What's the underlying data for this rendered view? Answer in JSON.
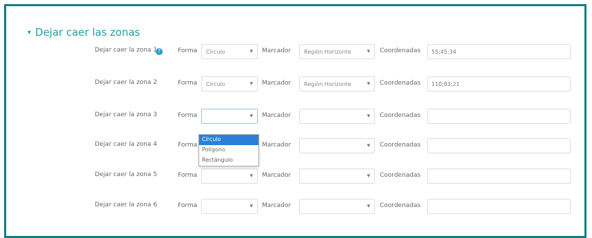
{
  "section": {
    "title": "Dejar caer las zonas",
    "caret": "▾"
  },
  "labels": {
    "shape": "Forma",
    "marker": "Marcador",
    "coords": "Coordenadas"
  },
  "help_icon_glyph": "?",
  "rows": [
    {
      "label": "Dejar caer la zona 1",
      "shape": "Círculo",
      "marker": "Región Horizonte",
      "coords": "55;45;34"
    },
    {
      "label": "Dejar caer la zona 2",
      "shape": "Círculo",
      "marker": "Región Horizonte",
      "coords": "110;83;21"
    },
    {
      "label": "Dejar caer la zona 3",
      "shape": "",
      "marker": "",
      "coords": ""
    },
    {
      "label": "Dejar caer la zona 4",
      "shape": "",
      "marker": "",
      "coords": ""
    },
    {
      "label": "Dejar caer la zona 5",
      "shape": "",
      "marker": "",
      "coords": ""
    },
    {
      "label": "Dejar caer la zona 6",
      "shape": "",
      "marker": "",
      "coords": ""
    }
  ],
  "dropdown": {
    "options": [
      "Círculo",
      "Polígono",
      "Rectángulo"
    ],
    "selected": "Círculo"
  },
  "colors": {
    "accent": "#1aa3a3",
    "frame": "#0f7f7f",
    "highlight": "#2a80d8",
    "help": "#2a9bd0"
  }
}
